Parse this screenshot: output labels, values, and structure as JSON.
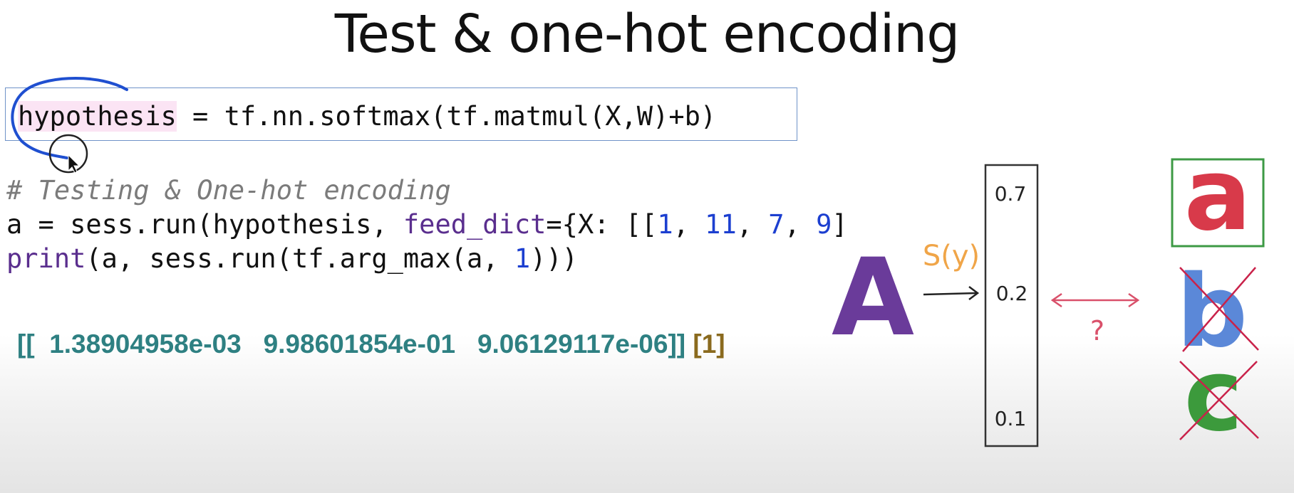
{
  "slide": {
    "title": "Test & one-hot encoding"
  },
  "code": {
    "hypothesis_var": "hypothesis",
    "hypothesis_rest": " = tf.nn.softmax(tf.matmul(X,W)+b)",
    "comment": "# Testing & One-hot encoding",
    "run_line": {
      "p1": "a = sess.run(hypothesis, ",
      "kwarg": "feed_dict",
      "p2": "={X: [[",
      "n1": "1",
      "s1": ", ",
      "n2": "11",
      "s2": ", ",
      "n3": "7",
      "s3": ", ",
      "n4": "9",
      "p3": "]"
    },
    "print_line": {
      "fn": "print",
      "p1": "(a, sess.run(tf.arg_max(a, ",
      "n1": "1",
      "p2": ")))"
    }
  },
  "output": {
    "array_text": "[[  1.38904958e-03   9.98601854e-01   9.06129117e-06]]",
    "index_text": "[1]"
  },
  "diagram": {
    "input_letter": "A",
    "function_label": "S(y)",
    "probabilities": [
      "0.7",
      "0.2",
      "0.1"
    ],
    "compare_symbol": "?",
    "candidates": [
      "a",
      "b",
      "c"
    ],
    "colors": {
      "input": "#6a3b9a",
      "function": "#f0a548",
      "compare": "#d9506a",
      "cand_a": "#d83a4a",
      "cand_b": "#5b88d8",
      "cand_c": "#3c9a3c",
      "cross": "#c9224a",
      "highlight_box": "#3d9a45",
      "annotation": "#1f4fd0"
    },
    "icons": [
      "cursor-icon",
      "right-arrow-icon",
      "double-arrow-icon",
      "cross-icon"
    ]
  }
}
